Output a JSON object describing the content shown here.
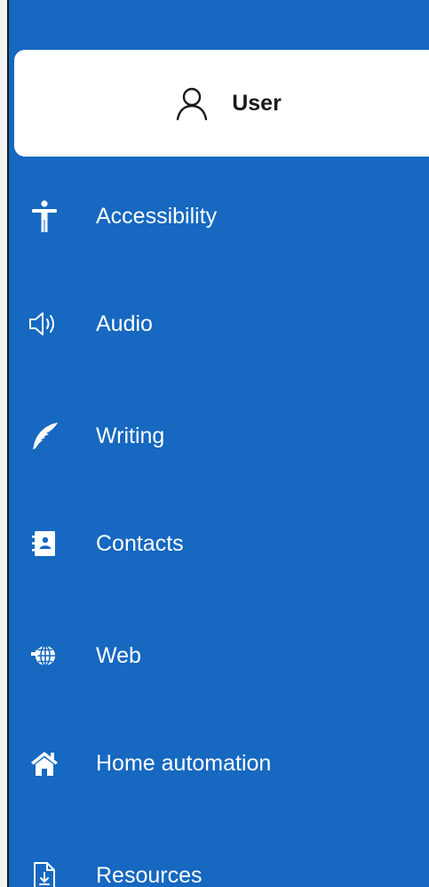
{
  "colors": {
    "sidebar_background": "#1668c0",
    "selected_background": "#ffffff",
    "selected_text": "#1a1a1a",
    "item_text": "#ffffff"
  },
  "user_tab": {
    "label": "User",
    "icon": "person-outline-icon"
  },
  "nav": {
    "items": [
      {
        "label": "Accessibility",
        "icon": "accessibility-icon"
      },
      {
        "label": "Audio",
        "icon": "speaker-icon"
      },
      {
        "label": "Writing",
        "icon": "quill-feather-icon"
      },
      {
        "label": "Contacts",
        "icon": "contact-card-icon"
      },
      {
        "label": "Web",
        "icon": "globe-icon"
      },
      {
        "label": "Home automation",
        "icon": "home-icon"
      },
      {
        "label": "Resources",
        "icon": "download-document-icon"
      }
    ]
  }
}
